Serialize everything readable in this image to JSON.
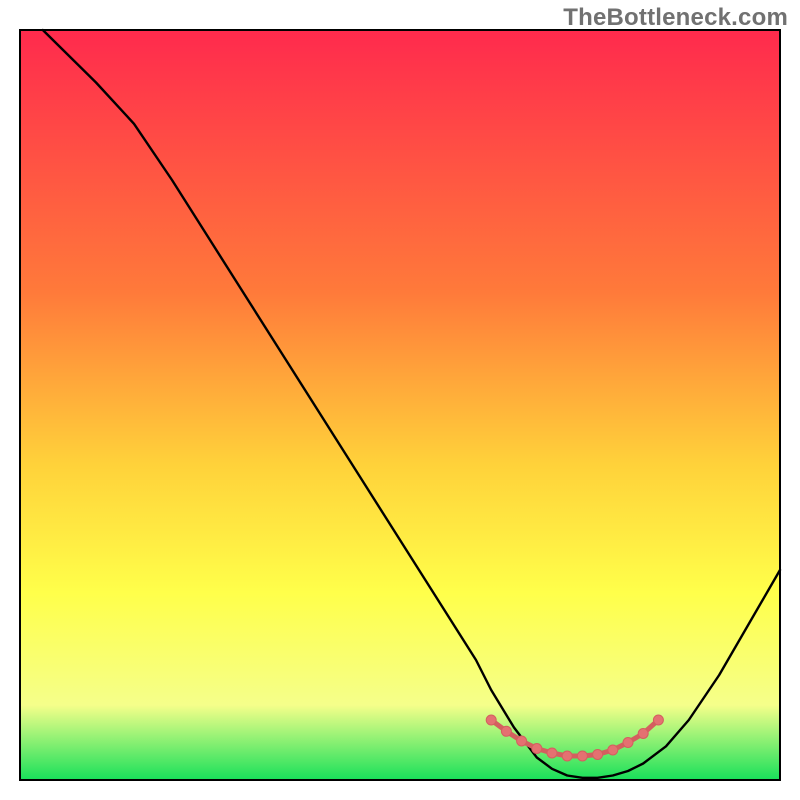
{
  "watermark": "TheBottleneck.com",
  "colors": {
    "curve": "#000000",
    "marker_fill": "#e47171",
    "marker_stroke": "#d45f5f",
    "frame": "#000000",
    "grad_top": "#ff2a4d",
    "grad_mid1": "#ff7a3a",
    "grad_mid2": "#ffd23a",
    "grad_mid3": "#ffff4a",
    "grad_mid4": "#f5ff8a",
    "grad_bottom": "#18e05a"
  },
  "chart_data": {
    "type": "line",
    "title": "",
    "xlabel": "",
    "ylabel": "",
    "xlim": [
      0,
      100
    ],
    "ylim": [
      0,
      100
    ],
    "series": [
      {
        "name": "bottleneck-curve",
        "x": [
          3,
          6,
          10,
          15,
          20,
          25,
          30,
          35,
          40,
          45,
          50,
          55,
          60,
          62,
          65,
          68,
          70,
          72,
          74,
          76,
          78,
          80,
          82,
          85,
          88,
          92,
          96,
          100
        ],
        "y": [
          100,
          97,
          93,
          87.5,
          80,
          72,
          64,
          56,
          48,
          40,
          32,
          24,
          16,
          12,
          7,
          3,
          1.5,
          0.6,
          0.3,
          0.3,
          0.6,
          1.2,
          2.2,
          4.5,
          8,
          14,
          21,
          28
        ]
      }
    ],
    "markers": {
      "name": "bottom-markers",
      "x": [
        62,
        64,
        66,
        68,
        70,
        72,
        74,
        76,
        78,
        80,
        82,
        84
      ],
      "y": [
        8,
        6.5,
        5.2,
        4.2,
        3.6,
        3.2,
        3.2,
        3.4,
        4.0,
        5.0,
        6.2,
        8
      ]
    }
  }
}
